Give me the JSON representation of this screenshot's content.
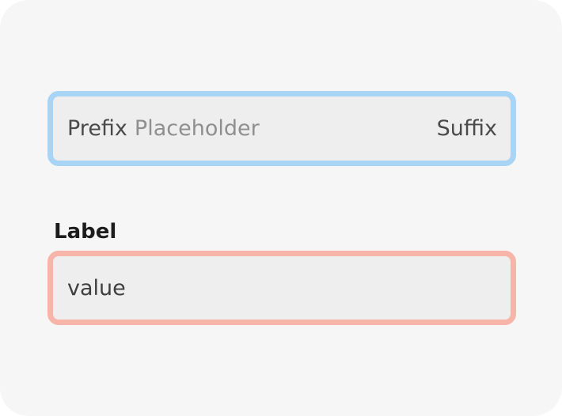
{
  "focused_field": {
    "prefix": "Prefix",
    "placeholder": "Placeholder",
    "value": "",
    "suffix": "Suffix",
    "state": "focused",
    "border_color": "#a8d5f5"
  },
  "labeled_field": {
    "label": "Label",
    "value": "value",
    "state": "error",
    "border_color": "#f7b4a8"
  },
  "colors": {
    "card_background": "#f6f6f7",
    "input_background": "#eeeeee",
    "text": "#3f3f3f",
    "placeholder": "#8f8f8f",
    "label": "#1c1c1c"
  }
}
